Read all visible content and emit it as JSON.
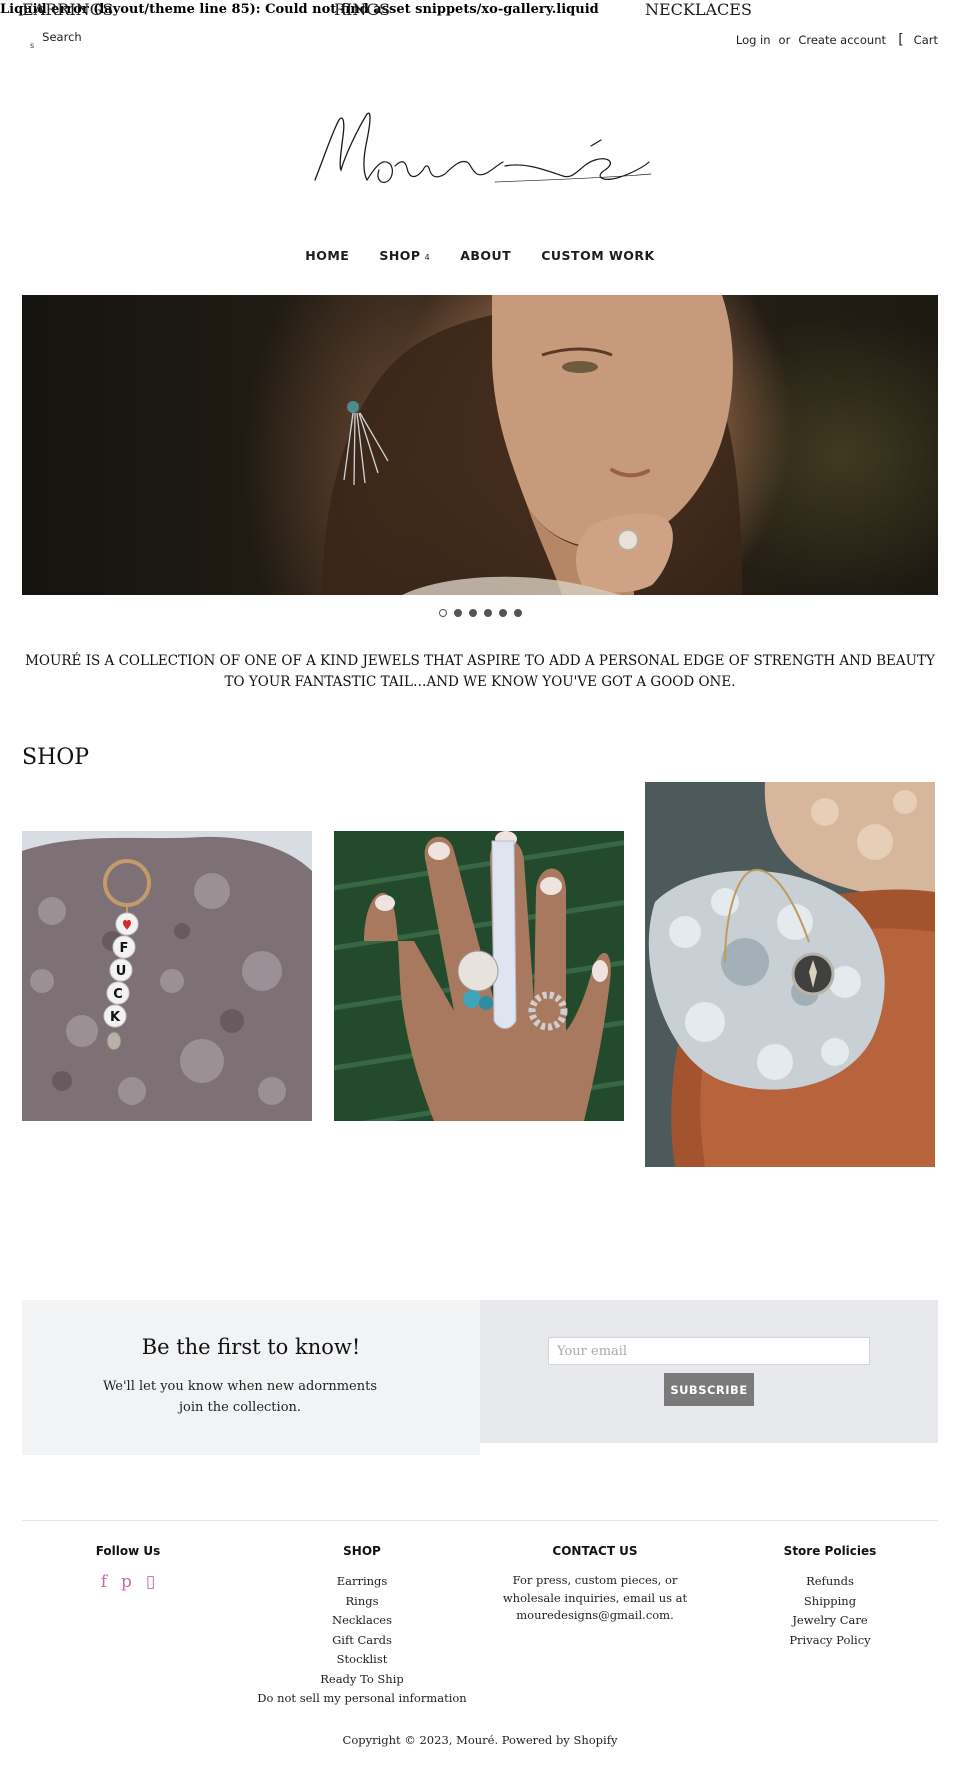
{
  "error_banner": "Liquid error (layout/theme line 85): Could not find asset snippets/xo-gallery.liquid",
  "topbar": {
    "search_glyph": "s",
    "search_label": "Search",
    "login": "Log in",
    "or": "or",
    "create_account": "Create account",
    "cart_glyph": "[",
    "cart": "Cart"
  },
  "logo_text": "Mouré",
  "nav": {
    "items": [
      "HOME",
      "SHOP",
      "ABOUT",
      "CUSTOM WORK"
    ],
    "shop_caret": "4"
  },
  "slideshow": {
    "slide_count": 6,
    "active_index": 0
  },
  "tagline": "MOURÉ IS A COLLECTION OF ONE OF A KIND JEWELS THAT ASPIRE TO ADD A PERSONAL EDGE OF STRENGTH AND BEAUTY TO YOUR FANTASTIC TAIL…AND WE KNOW YOU'VE GOT A GOOD ONE.",
  "shop": {
    "heading": "SHOP",
    "products": [
      {
        "label": "EARRINGS"
      },
      {
        "label": "RINGS"
      },
      {
        "label": "NECKLACES"
      }
    ],
    "beads": [
      "F",
      "U",
      "C",
      "K"
    ]
  },
  "newsletter": {
    "title": "Be the first to know!",
    "subtitle": "We'll let you know when new adornments join the collection.",
    "placeholder": "Your email",
    "button": "SUBSCRIBE"
  },
  "footer": {
    "follow": {
      "title": "Follow Us",
      "icons": [
        "facebook-icon",
        "pinterest-icon",
        "instagram-icon"
      ],
      "glyphs": [
        "f",
        "p",
        "▯"
      ]
    },
    "shop": {
      "title": "SHOP",
      "links": [
        "Earrings",
        "Rings",
        "Necklaces",
        "Gift Cards",
        "Stocklist",
        "Ready To Ship",
        "Do not sell my personal information"
      ]
    },
    "contact": {
      "title": "CONTACT US",
      "text": "For press, custom pieces, or wholesale inquiries, email us at mouredesigns@gmail.com."
    },
    "policies": {
      "title": "Store Policies",
      "links": [
        "Refunds",
        "Shipping",
        "Jewelry Care",
        "Privacy Policy"
      ]
    },
    "copyright": "Copyright © 2023, Mouré. Powered by Shopify"
  },
  "colors": {
    "accent_social": "#c96aa8",
    "subscribe_bg": "#7a7a7a",
    "news_left_bg": "#f2f3f5",
    "news_right_bg": "#e7e9ec"
  }
}
